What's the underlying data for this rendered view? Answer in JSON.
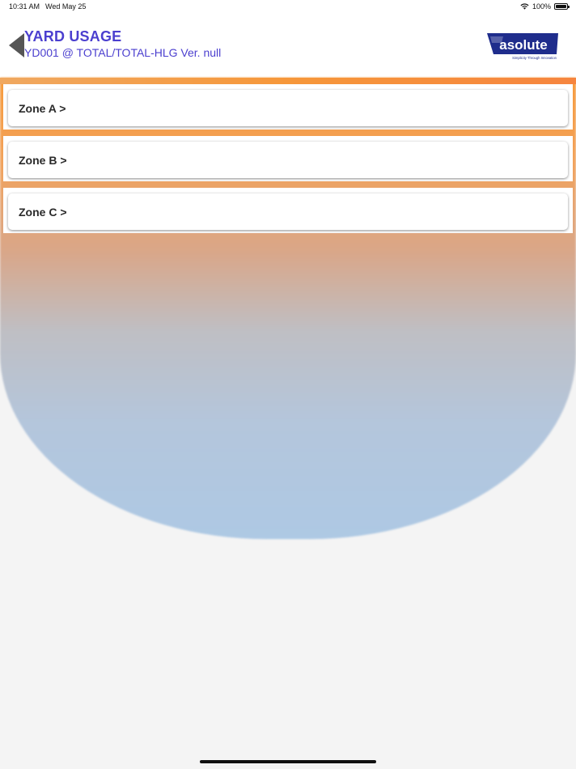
{
  "status_bar": {
    "time": "10:31 AM",
    "date": "Wed May 25",
    "battery": "100%",
    "wifi_icon": "wifi-icon",
    "battery_icon": "battery-icon"
  },
  "header": {
    "title": "YARD USAGE",
    "subtitle": "YD001 @ TOTAL/TOTAL-HLG Ver. null",
    "back_icon": "back-arrow-icon",
    "logo": {
      "name": "asolute",
      "tagline": "Simplicity Through Innovation"
    }
  },
  "zones": [
    {
      "label": "Zone A >"
    },
    {
      "label": "Zone B >"
    },
    {
      "label": "Zone C >"
    }
  ],
  "colors": {
    "title": "#4b3fcf",
    "logo_blue": "#1f2d8c",
    "gradient_top": "#f79a3a",
    "gradient_bottom": "#aec9e4"
  }
}
